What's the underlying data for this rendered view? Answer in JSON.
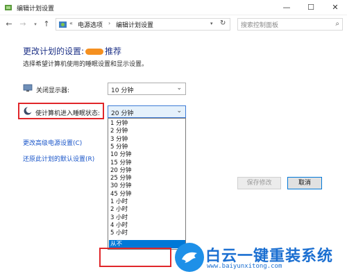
{
  "window": {
    "title": "编辑计划设置",
    "controls": {
      "minimize": "—",
      "maximize": "☐",
      "close": "✕"
    }
  },
  "navigation": {
    "back_glyph": "←",
    "forward_glyph": "→",
    "up_glyph": "↑",
    "breadcrumb_prefix": "«",
    "breadcrumbs": [
      "电源选项",
      "编辑计划设置"
    ],
    "breadcrumb_separator": "›",
    "search_placeholder": "搜索控制面板"
  },
  "page": {
    "title_prefix": "更改计划的设置:",
    "title_suffix": "推荐",
    "subtitle": "选择希望计算机使用的睡眠设置和显示设置。"
  },
  "settings": {
    "display_off": {
      "label": "关闭显示器:",
      "value": "10 分钟",
      "icon": "monitor-icon"
    },
    "sleep": {
      "label": "使计算机进入睡眠状态:",
      "value": "20 分钟",
      "icon": "moon-icon"
    }
  },
  "links": {
    "advanced": "更改高级电源设置(C)",
    "restore": "还原此计划的默认设置(R)"
  },
  "sleep_options": [
    "1 分钟",
    "2 分钟",
    "3 分钟",
    "5 分钟",
    "10 分钟",
    "15 分钟",
    "20 分钟",
    "25 分钟",
    "30 分钟",
    "45 分钟",
    "1 小时",
    "2 小时",
    "3 小时",
    "4 小时",
    "5 小时",
    "从不"
  ],
  "sleep_selected_index": 15,
  "buttons": {
    "save": "保存修改",
    "cancel": "取消"
  },
  "watermark": {
    "title": "白云一键重装系统",
    "url": "www.baiyunxitong.com"
  },
  "colors": {
    "accent": "#0078d7",
    "highlight": "#e0262a",
    "title": "#1e3287",
    "link": "#1a56c9"
  }
}
